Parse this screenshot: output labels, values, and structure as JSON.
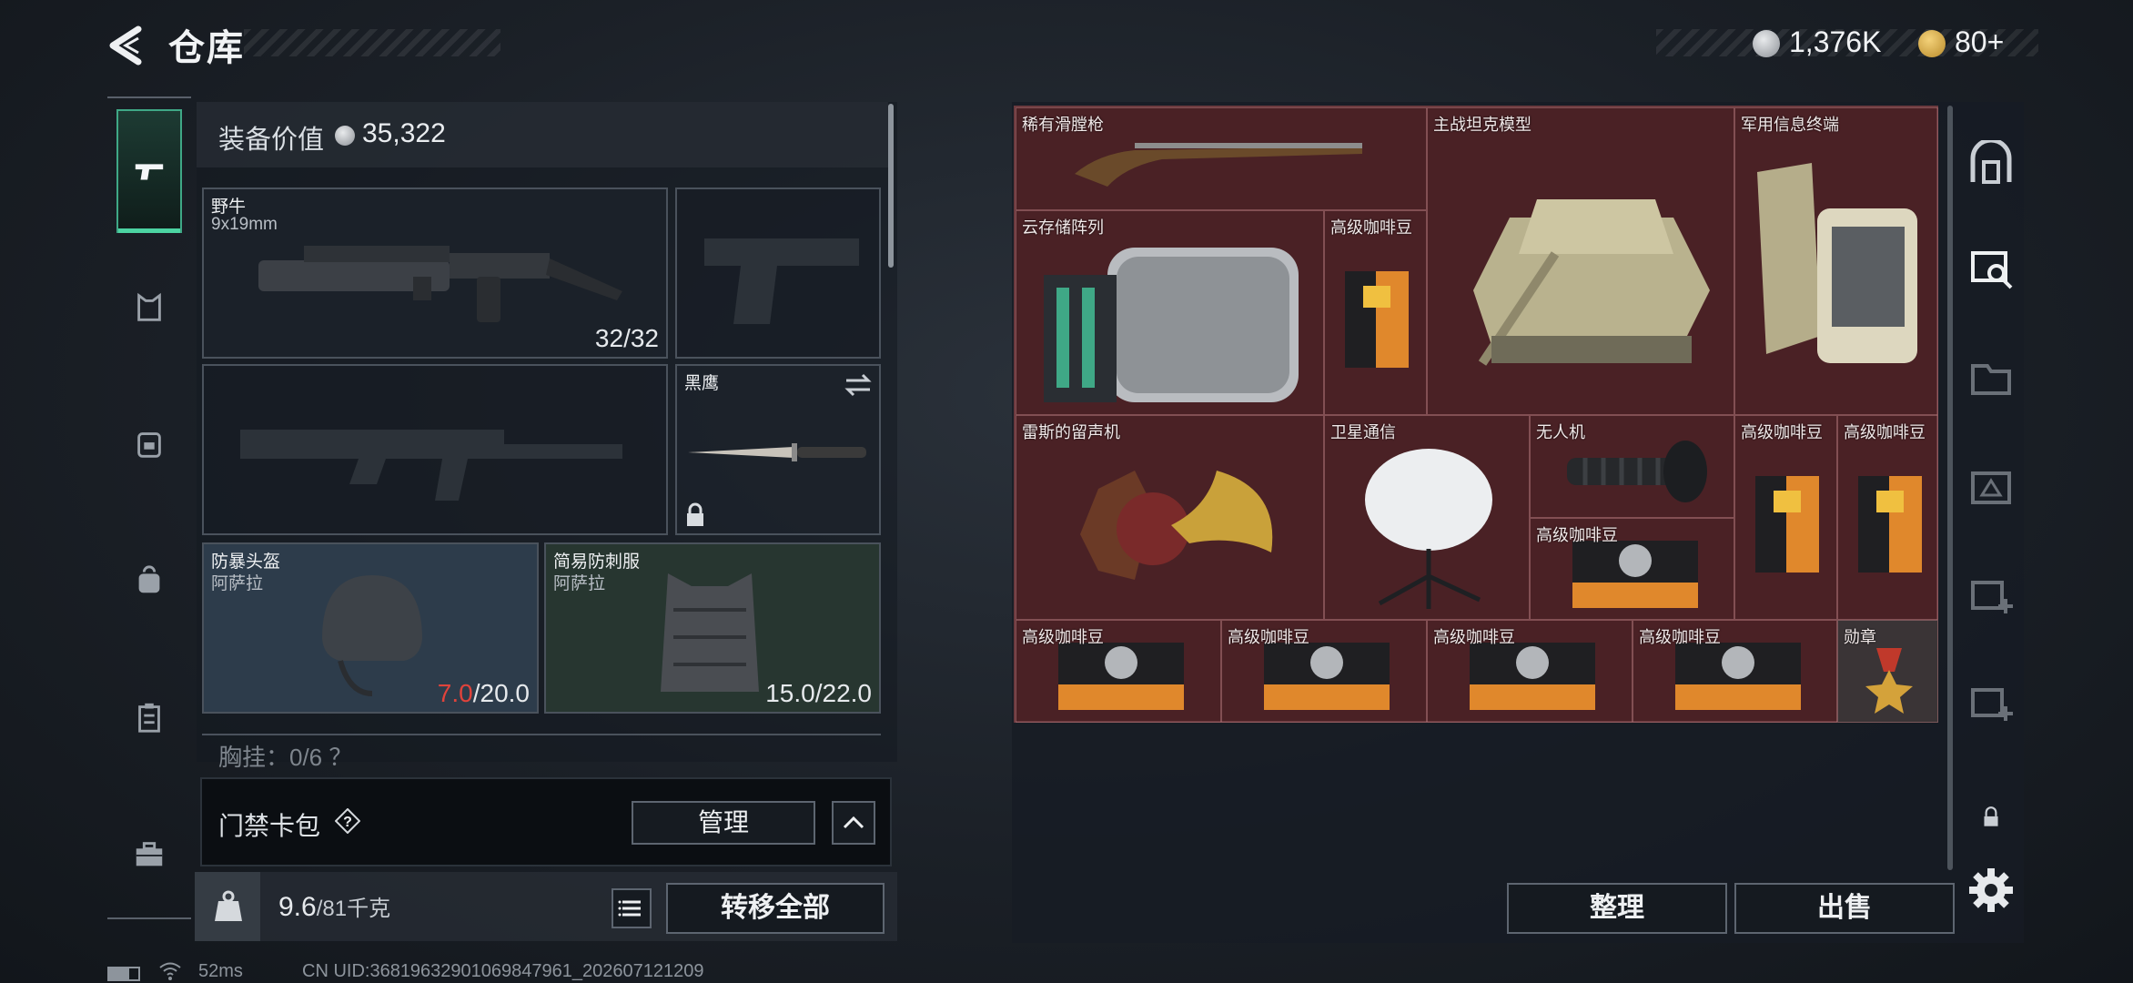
{
  "header": {
    "title": "仓库",
    "currencies": [
      {
        "name": "silver-coin",
        "value": "1,376K",
        "color": "#c9ccd0"
      },
      {
        "name": "gold-coin",
        "value": "80+",
        "color": "#e0b04a"
      }
    ]
  },
  "categories": [
    {
      "icon": "pistol-icon",
      "active": true
    },
    {
      "icon": "armor-vest-icon",
      "active": false
    },
    {
      "icon": "rig-icon",
      "active": false
    },
    {
      "icon": "backpack-icon",
      "active": false
    },
    {
      "icon": "clipboard-icon",
      "active": false
    },
    {
      "icon": "toolbox-icon",
      "active": false
    }
  ],
  "equipment": {
    "value_label": "装备价值",
    "value": "35,322",
    "slots": {
      "primary": {
        "name": "野牛",
        "ammo": "9x19mm",
        "count": "32/32"
      },
      "sidearm": {
        "name": "",
        "empty": true
      },
      "secondary": {
        "name": "",
        "empty": true
      },
      "melee": {
        "name": "黑鹰",
        "locked": true
      },
      "helmet": {
        "name": "防暴头盔",
        "sub": "阿萨拉",
        "durability_current": "7.0",
        "durability_max": "/20.0"
      },
      "armor": {
        "name": "简易防刺服",
        "sub": "阿萨拉",
        "durability": "15.0/22.0"
      }
    },
    "chest_rig_label": "胸挂：0/6 ？"
  },
  "keycard": {
    "label": "门禁卡包",
    "help": "?",
    "manage_label": "管理"
  },
  "weight": {
    "current": "9.6",
    "max": "/81千克",
    "transfer_label": "转移全部"
  },
  "status": {
    "ping": "52ms",
    "uid": "CN UID:3681963290106984796​1_202607121209"
  },
  "stash": {
    "items": [
      {
        "name": "稀有滑膛枪"
      },
      {
        "name": "主战坦克模型"
      },
      {
        "name": "军用信息终端"
      },
      {
        "name": "云存储阵列"
      },
      {
        "name": "高级咖啡豆"
      },
      {
        "name": "雷斯的留声机"
      },
      {
        "name": "卫星通信"
      },
      {
        "name": "无人机"
      },
      {
        "name": "高级咖啡豆"
      },
      {
        "name": "高级咖啡豆"
      },
      {
        "name": "高级咖啡豆"
      },
      {
        "name": "高级咖啡豆"
      },
      {
        "name": "高级咖啡豆"
      },
      {
        "name": "高级咖啡豆"
      },
      {
        "name": "高级咖啡豆"
      },
      {
        "name": "勋章"
      }
    ],
    "sort_label": "整理",
    "sell_label": "出售"
  },
  "side_tabs": [
    {
      "icon": "safe-box-icon"
    },
    {
      "icon": "stash-search-icon"
    },
    {
      "icon": "storage-folder-icon"
    },
    {
      "icon": "storage-triangle-icon"
    },
    {
      "icon": "add-storage-icon"
    },
    {
      "icon": "add-storage-icon"
    },
    {
      "icon": "lock-icon"
    }
  ]
}
